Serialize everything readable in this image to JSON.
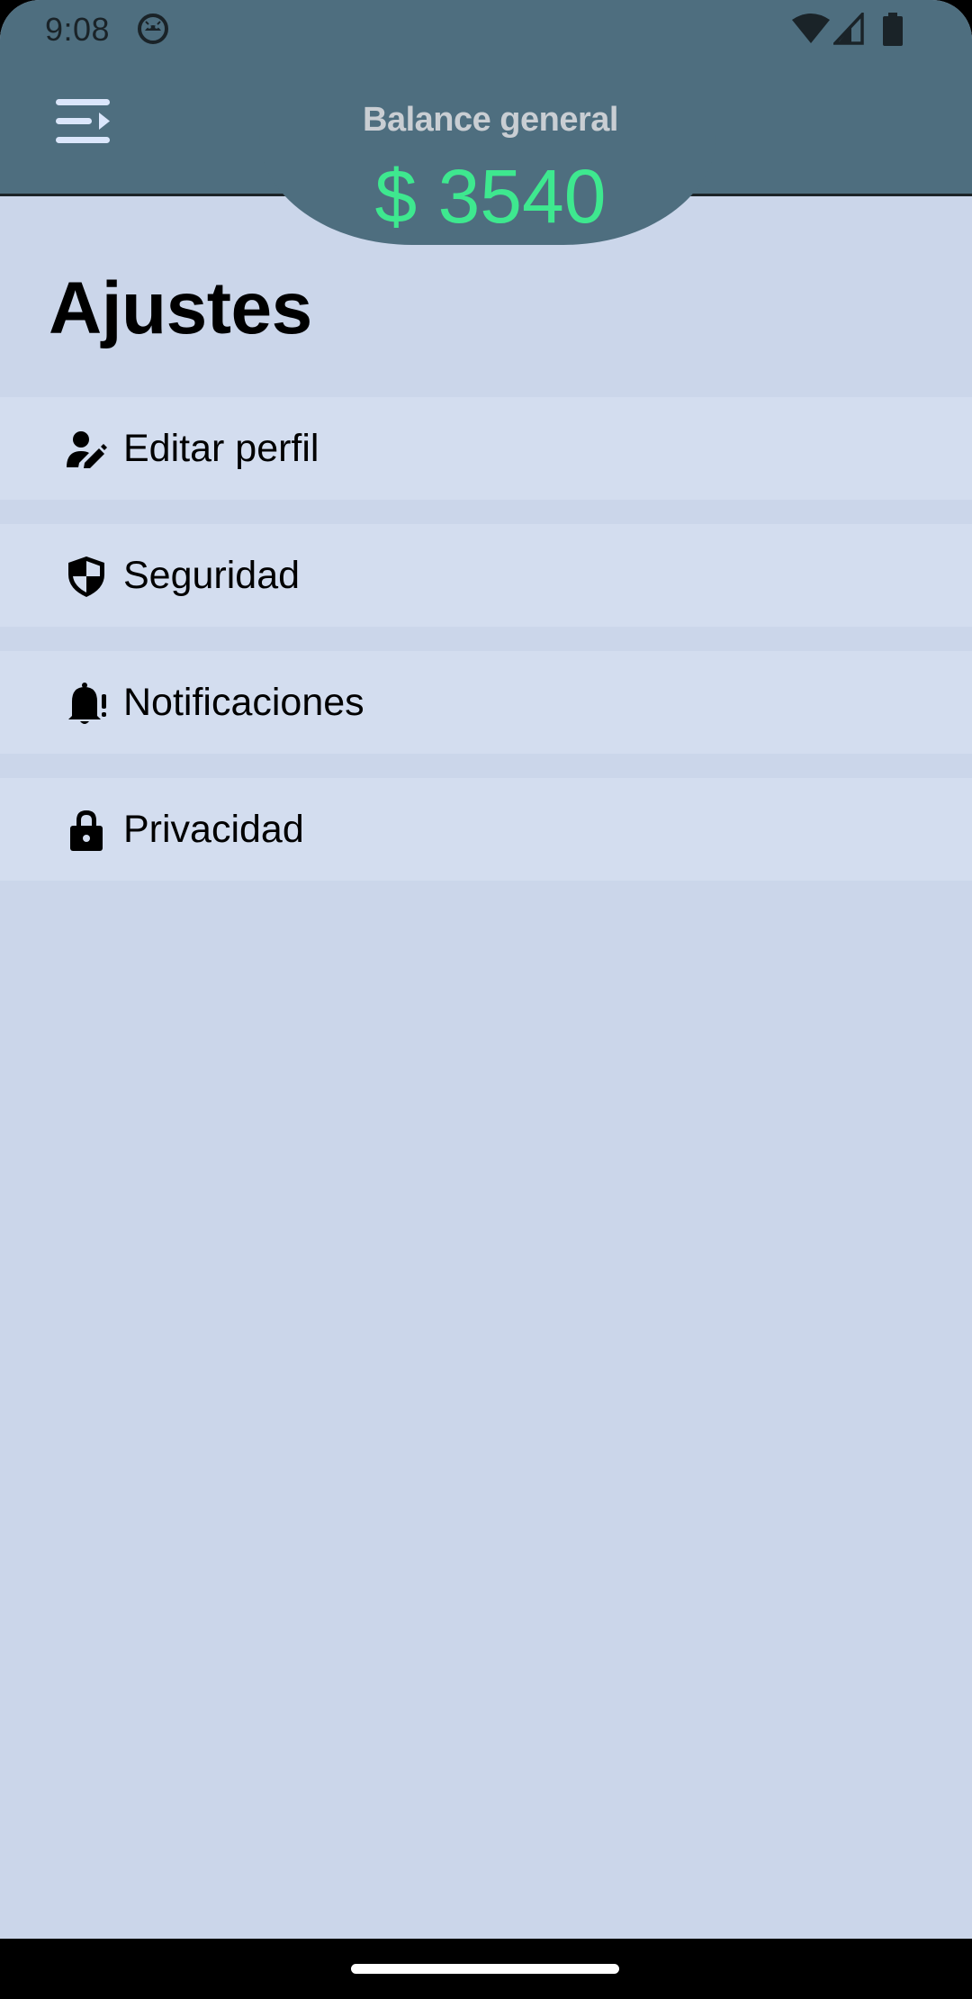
{
  "status_bar": {
    "time": "9:08",
    "app_icon": "android-face-icon",
    "wifi_icon": "wifi-icon",
    "signal_icon": "cell-signal-icon",
    "battery_icon": "battery-icon"
  },
  "header": {
    "menu_icon": "menu-open-icon",
    "balance_label": "Balance general",
    "balance_amount": "$ 3540",
    "colors": {
      "background": "#4e6e7f",
      "amount": "#3ee88f",
      "label": "#c9ced3"
    }
  },
  "main": {
    "title": "Ajustes",
    "items": [
      {
        "label": "Editar perfil",
        "icon": "person-edit-icon"
      },
      {
        "label": "Seguridad",
        "icon": "shield-icon"
      },
      {
        "label": "Notificaciones",
        "icon": "bell-alert-icon"
      },
      {
        "label": "Privacidad",
        "icon": "lock-icon"
      }
    ]
  },
  "colors": {
    "page_background": "#cbd6ea",
    "item_background": "#d3ddef"
  }
}
